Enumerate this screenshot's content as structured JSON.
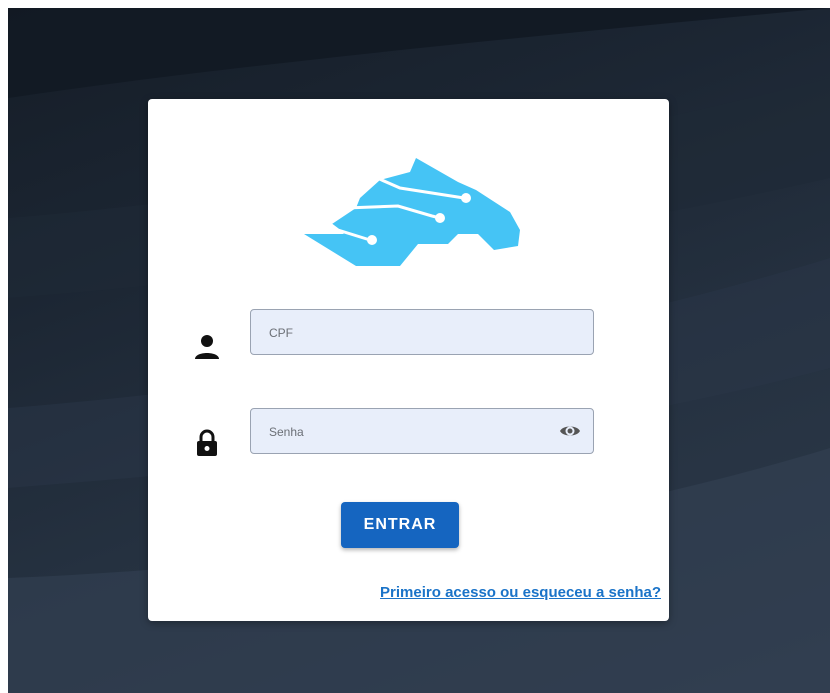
{
  "login": {
    "cpf_placeholder": "CPF",
    "senha_placeholder": "Senha",
    "submit_label": "ENTRAR",
    "forgot_link": "Primeiro acesso ou esqueceu a senha?"
  },
  "icons": {
    "user": "person-icon",
    "password": "lock-icon",
    "toggle_visibility": "eye-icon",
    "logo": "horse-circuit-logo"
  },
  "colors": {
    "logo": "#45c4f5",
    "button": "#1565c0",
    "link": "#1a73c8",
    "field_bg": "#e8eefa"
  }
}
